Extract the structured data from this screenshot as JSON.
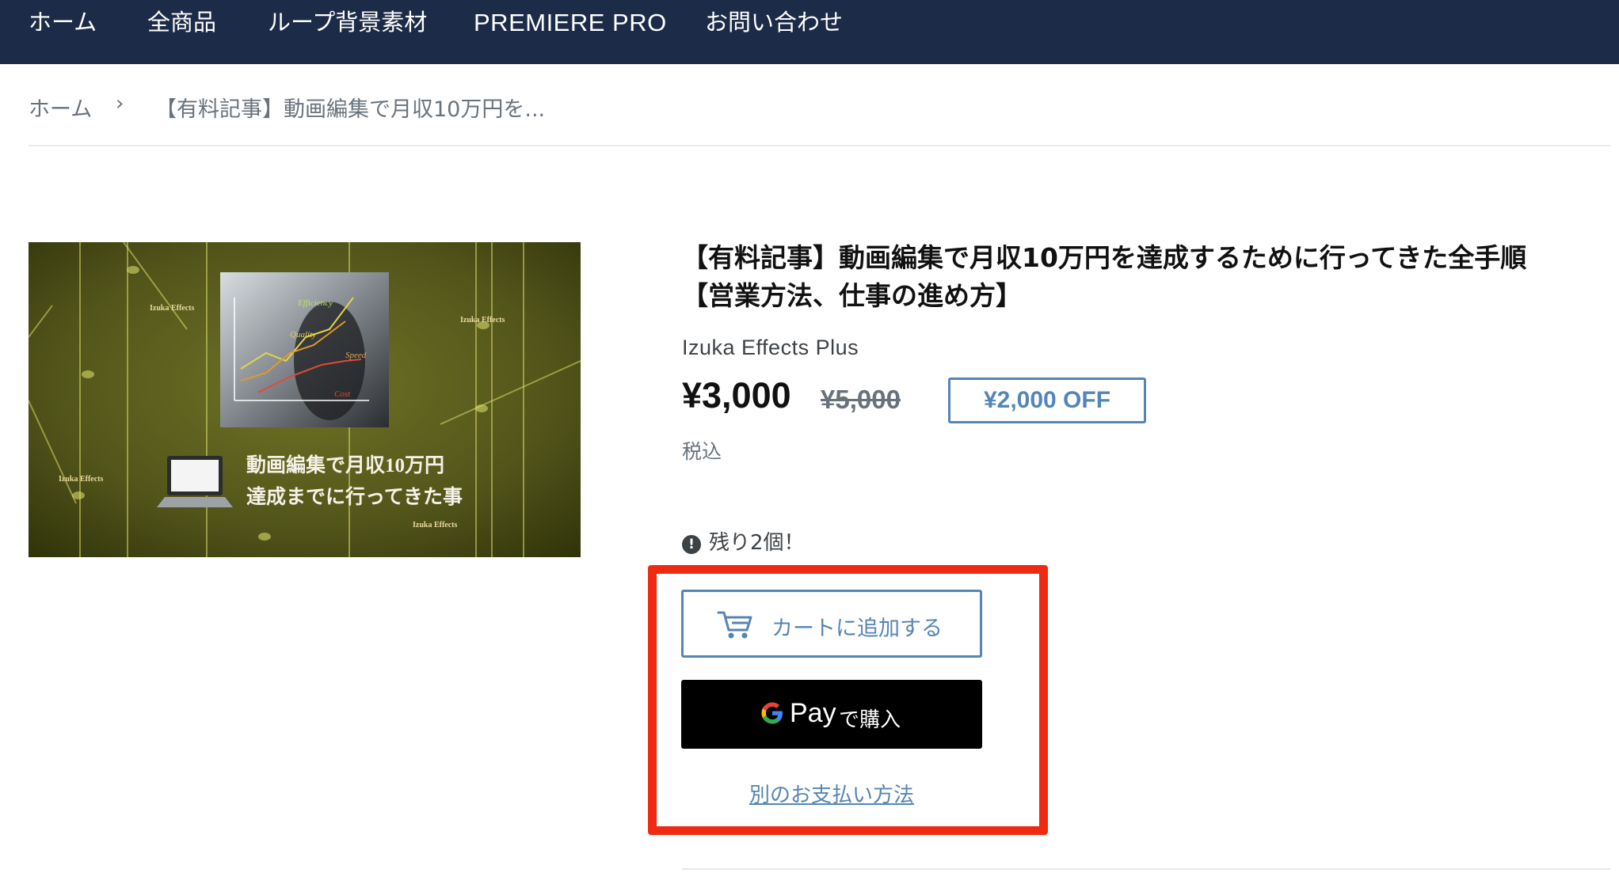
{
  "nav": {
    "items": [
      {
        "label": "ホーム"
      },
      {
        "label": "全商品"
      },
      {
        "label": "ループ背景素材"
      },
      {
        "label": "PREMIERE PRO"
      },
      {
        "label": "お問い合わせ"
      }
    ],
    "background": "#1c2b47"
  },
  "breadcrumb": {
    "home": "ホーム",
    "separator": "›",
    "current": "【有料記事】動画編集で月収10万円を..."
  },
  "product": {
    "image": {
      "title_line1": "動画編集で月収10万円",
      "title_line2": "達成までに行ってきた事",
      "watermark": "Izuka Effects",
      "chart_labels": [
        "Efficiency",
        "Quality",
        "Speed",
        "Cost"
      ]
    },
    "title": "【有料記事】動画編集で月収10万円を達成するために行ってきた全手順【営業方法、仕事の進め方】",
    "vendor": "Izuka Effects Plus",
    "price_sale": "¥3,000",
    "price_regular": "¥5,000",
    "price_badge": "¥2,000 OFF",
    "tax_note": "税込",
    "stock_icon": "!",
    "stock_text": "残り2個！",
    "add_to_cart": "カートに追加する",
    "gpay_pay": "Pay",
    "gpay_suffix": "で購入",
    "more_payment": "別のお支払い方法"
  },
  "colors": {
    "accent": "#5585b5",
    "highlight": "#ee2a12",
    "text": "#3d4246"
  }
}
